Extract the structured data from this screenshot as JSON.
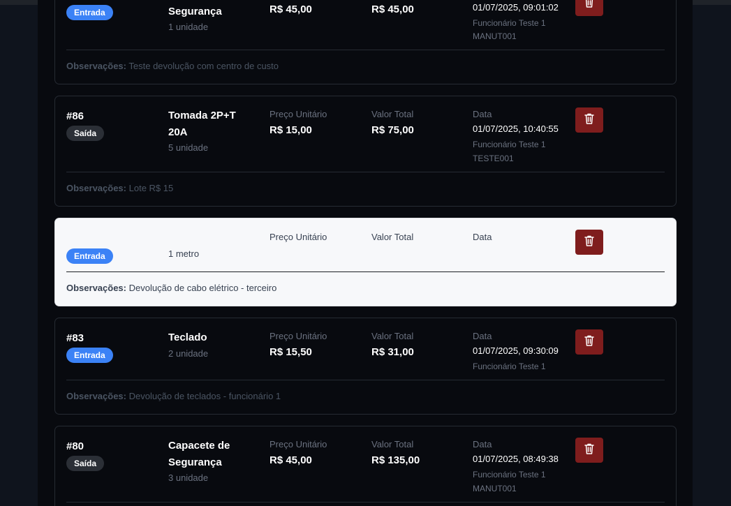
{
  "colors": {
    "entrada": "#3b82f6",
    "saida": "#2b2f36",
    "delete": "#7f1d1d"
  },
  "labels": {
    "unit_price": "Preço Unitário",
    "total_value": "Valor Total",
    "date": "Data",
    "observations": "Observações:"
  },
  "cards": [
    {
      "badge": "Entrada",
      "name_line2": "Segurança",
      "qty": "1 unidade",
      "unit_price": "R$ 45,00",
      "total": "R$ 45,00",
      "date": "01/07/2025, 09:01:02",
      "employee": "Funcionário Teste 1",
      "code": "MANUT001",
      "obs": "Teste devolução com centro de custo",
      "delete_icon": "trash-icon"
    },
    {
      "id": "#86",
      "badge": "Saída",
      "name_line1": "Tomada 2P+T",
      "name_line2": "20A",
      "qty": "5 unidade",
      "unit_price": "R$ 15,00",
      "total": "R$ 75,00",
      "date": "01/07/2025, 10:40:55",
      "employee": "Funcionário Teste 1",
      "code": "TESTE001",
      "obs": "Lote R$ 15",
      "delete_icon": "trash-icon"
    },
    {
      "badge": "Entrada",
      "qty": "1 metro",
      "obs": "Devolução de cabo elétrico - terceiro",
      "delete_icon": "trash-icon"
    },
    {
      "id": "#83",
      "badge": "Entrada",
      "name_line1": "Teclado",
      "qty": "2 unidade",
      "unit_price": "R$ 15,50",
      "total": "R$ 31,00",
      "date": "01/07/2025, 09:30:09",
      "employee": "Funcionário Teste 1",
      "obs": "Devolução de teclados - funcionário 1",
      "delete_icon": "trash-icon"
    },
    {
      "id": "#80",
      "badge": "Saída",
      "name_line1": "Capacete de",
      "name_line2": "Segurança",
      "qty": "3 unidade",
      "unit_price": "R$ 45,00",
      "total": "R$ 135,00",
      "date": "01/07/2025, 08:49:38",
      "employee": "Funcionário Teste 1",
      "code": "MANUT001",
      "delete_icon": "trash-icon"
    }
  ]
}
